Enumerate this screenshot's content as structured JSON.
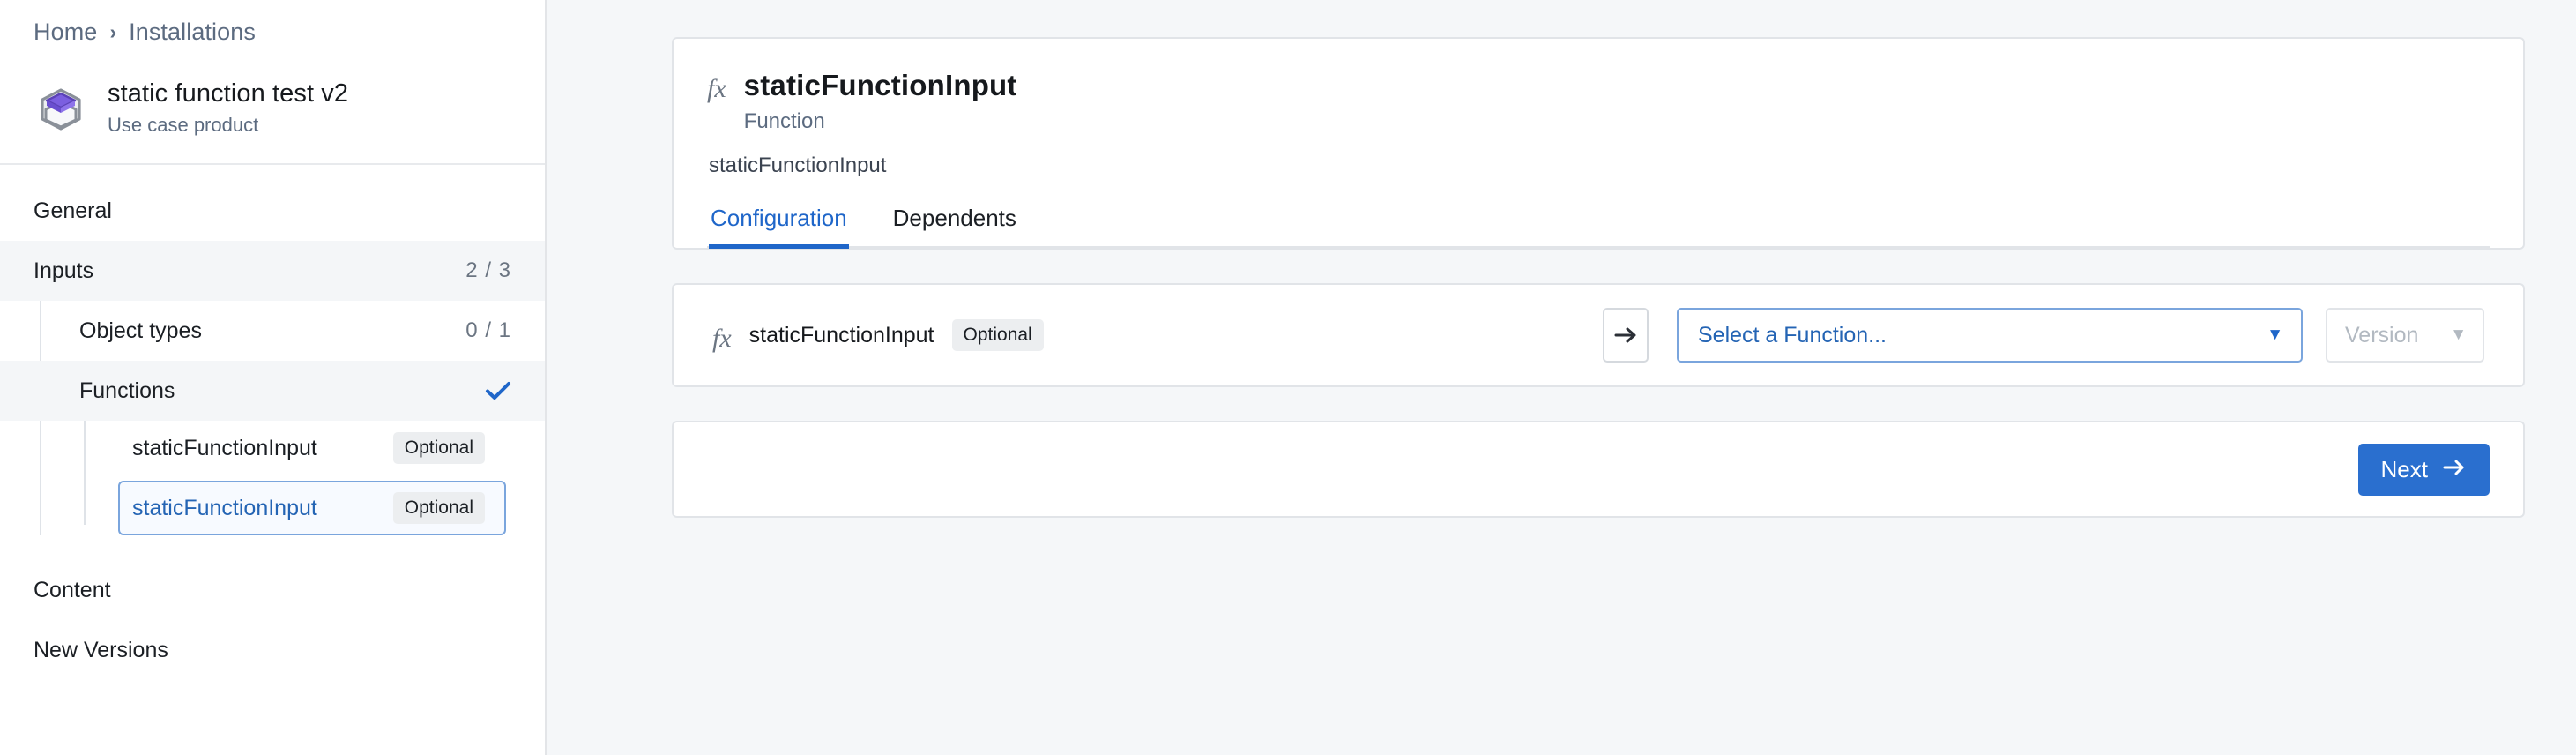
{
  "breadcrumb": {
    "home": "Home",
    "separator": "›",
    "current": "Installations"
  },
  "product": {
    "title": "static function test v2",
    "subtitle": "Use case product"
  },
  "sidebar": {
    "general": {
      "label": "General"
    },
    "inputs": {
      "label": "Inputs",
      "count": "2 / 3"
    },
    "object_types": {
      "label": "Object types",
      "count": "0 / 1"
    },
    "functions": {
      "label": "Functions"
    },
    "leaves": [
      {
        "label": "staticFunctionInput",
        "badge": "Optional"
      },
      {
        "label": "staticFunctionInput",
        "badge": "Optional"
      }
    ],
    "content": {
      "label": "Content"
    },
    "new_versions": {
      "label": "New Versions"
    }
  },
  "main": {
    "fx_icon": "fx",
    "title": "staticFunctionInput",
    "subtitle": "Function",
    "description": "staticFunctionInput",
    "tabs": [
      {
        "label": "Configuration",
        "active": true
      },
      {
        "label": "Dependents",
        "active": false
      }
    ],
    "mapping": {
      "fx_icon": "fx",
      "name": "staticFunctionInput",
      "badge": "Optional",
      "select_function": "Select a Function...",
      "version": "Version",
      "caret": "▼"
    },
    "footer": {
      "next_label": "Next"
    }
  },
  "colors": {
    "accent_blue": "#2a6fcf",
    "link_blue": "#2464b4",
    "tab_active": "#1f66c9",
    "purple": "#6b4fd8"
  }
}
